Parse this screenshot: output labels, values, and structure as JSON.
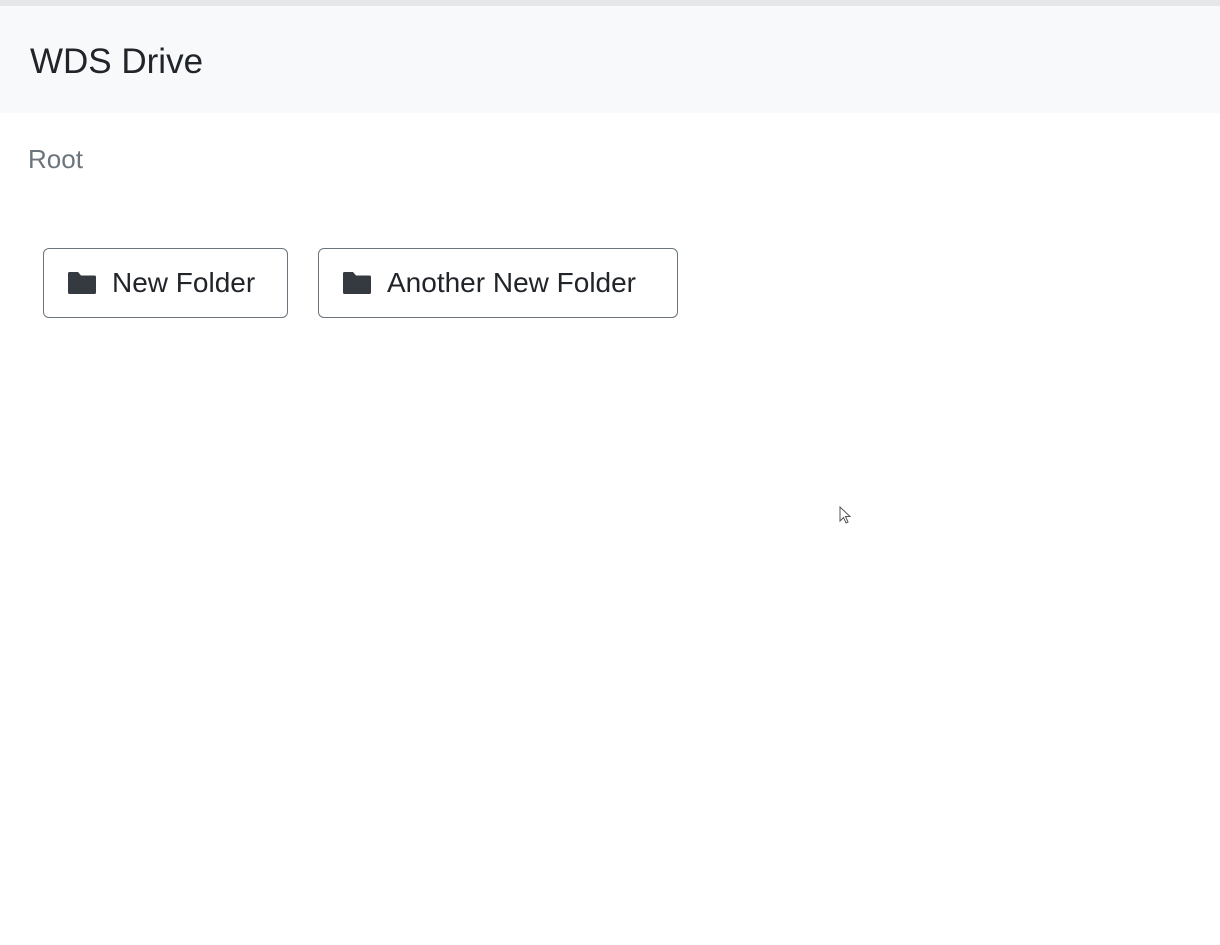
{
  "app": {
    "brand": "WDS Drive"
  },
  "breadcrumb": {
    "current": "Root"
  },
  "folders": [
    {
      "name": "New Folder",
      "icon": "folder-icon"
    },
    {
      "name": "Another New Folder",
      "icon": "folder-icon"
    }
  ],
  "colors": {
    "navbar_bg": "#f8f9fa",
    "breadcrumb_text": "#6c757d",
    "button_border": "#6c757d",
    "icon": "#343a40"
  }
}
